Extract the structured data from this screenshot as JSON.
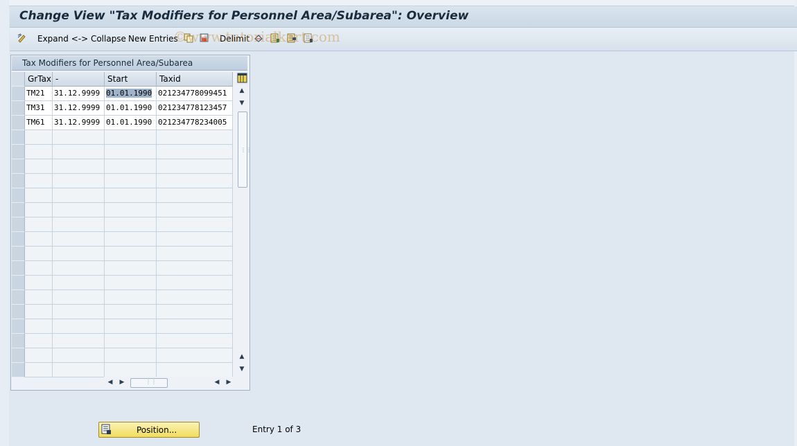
{
  "window": {
    "title": "Change View \"Tax Modifiers for Personnel Area/Subarea\": Overview"
  },
  "toolbar": {
    "expand_collapse_label": "Expand <-> Collapse",
    "new_entries_label": "New Entries",
    "delimit_label": "Delimit",
    "icons": [
      "edit-toggle-icon",
      "copy-icon",
      "save-as-icon",
      "undo-icon",
      "select-all-icon",
      "select-block-icon",
      "deselect-all-icon"
    ]
  },
  "watermark": "©www.tutorialkart.com",
  "table": {
    "title": "Tax Modifiers for Personnel Area/Subarea",
    "columns": [
      "GrTax",
      "-",
      "Start",
      "Taxid"
    ],
    "rows": [
      [
        "TM21",
        "31.12.9999",
        "01.01.1990",
        "021234778099451"
      ],
      [
        "TM31",
        "31.12.9999",
        "01.01.1990",
        "021234778123457"
      ],
      [
        "TM61",
        "31.12.9999",
        "01.01.1990",
        "021234778234005"
      ]
    ],
    "empty_rows": 17
  },
  "footer": {
    "position_label": "Position...",
    "entry_text": "Entry 1 of 3"
  },
  "colors": {
    "background": "#dfe8f1",
    "position_button": "#f1dc5e",
    "header": "#cfdae5"
  }
}
